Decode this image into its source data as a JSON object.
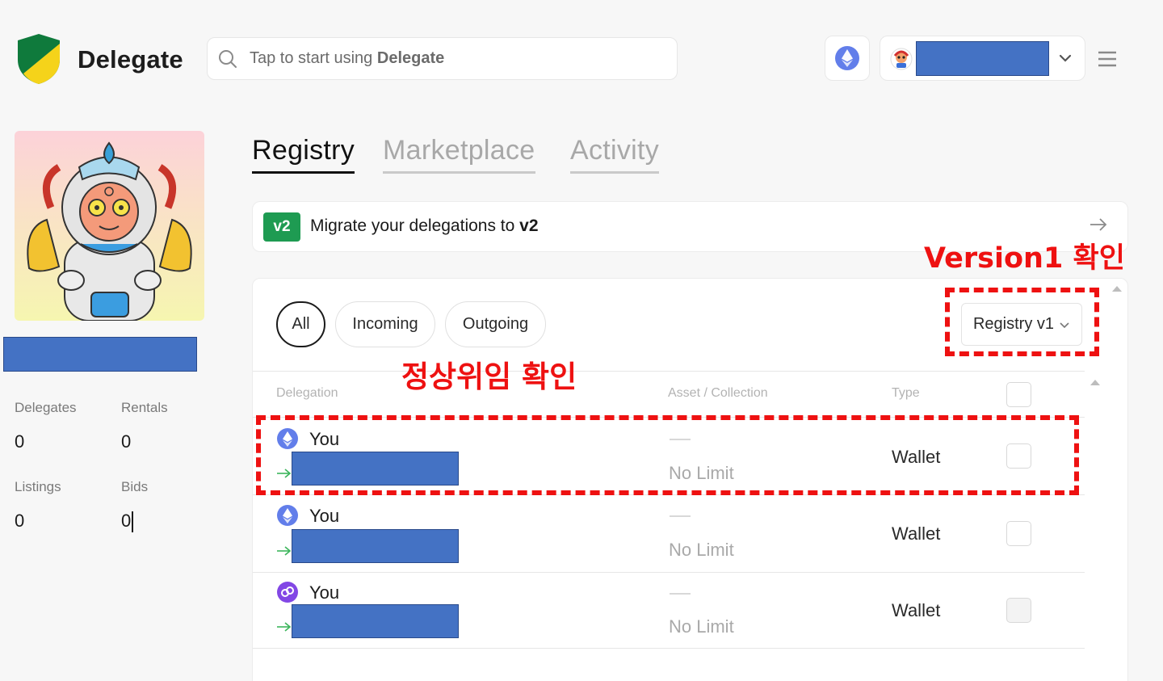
{
  "header": {
    "brand": "Delegate",
    "search_placeholder_prefix": "Tap to start using ",
    "search_placeholder_brand": "Delegate"
  },
  "profile": {
    "stats": [
      {
        "label": "Delegates",
        "value": "0"
      },
      {
        "label": "Rentals",
        "value": "0"
      },
      {
        "label": "Listings",
        "value": "0"
      },
      {
        "label": "Bids",
        "value": "0"
      }
    ]
  },
  "tabs": [
    {
      "label": "Registry",
      "active": true
    },
    {
      "label": "Marketplace",
      "active": false
    },
    {
      "label": "Activity",
      "active": false
    }
  ],
  "migrate": {
    "badge": "v2",
    "text_prefix": "Migrate your delegations to ",
    "text_bold": "v2"
  },
  "filters": {
    "all": "All",
    "incoming": "Incoming",
    "outgoing": "Outgoing",
    "registry_select": "Registry v1"
  },
  "table": {
    "headers": {
      "delegation": "Delegation",
      "asset": "Asset / Collection",
      "type": "Type"
    },
    "rows": [
      {
        "network": "ethereum",
        "from": "You",
        "asset_dash": "—",
        "limit": "No Limit",
        "type": "Wallet"
      },
      {
        "network": "ethereum",
        "from": "You",
        "asset_dash": "—",
        "limit": "No Limit",
        "type": "Wallet"
      },
      {
        "network": "polygon",
        "from": "You",
        "asset_dash": "—",
        "limit": "No Limit",
        "type": "Wallet"
      }
    ]
  },
  "annotations": {
    "version_check": "Version1 확인",
    "normal_delegation_check": "정상위임 확인"
  },
  "colors": {
    "redaction": "#4472c4",
    "annotation": "#ee1111",
    "v2_badge": "#1e9b52",
    "ethereum": "#627eea",
    "polygon": "#8247e5",
    "arrow_green": "#3cb55b"
  }
}
